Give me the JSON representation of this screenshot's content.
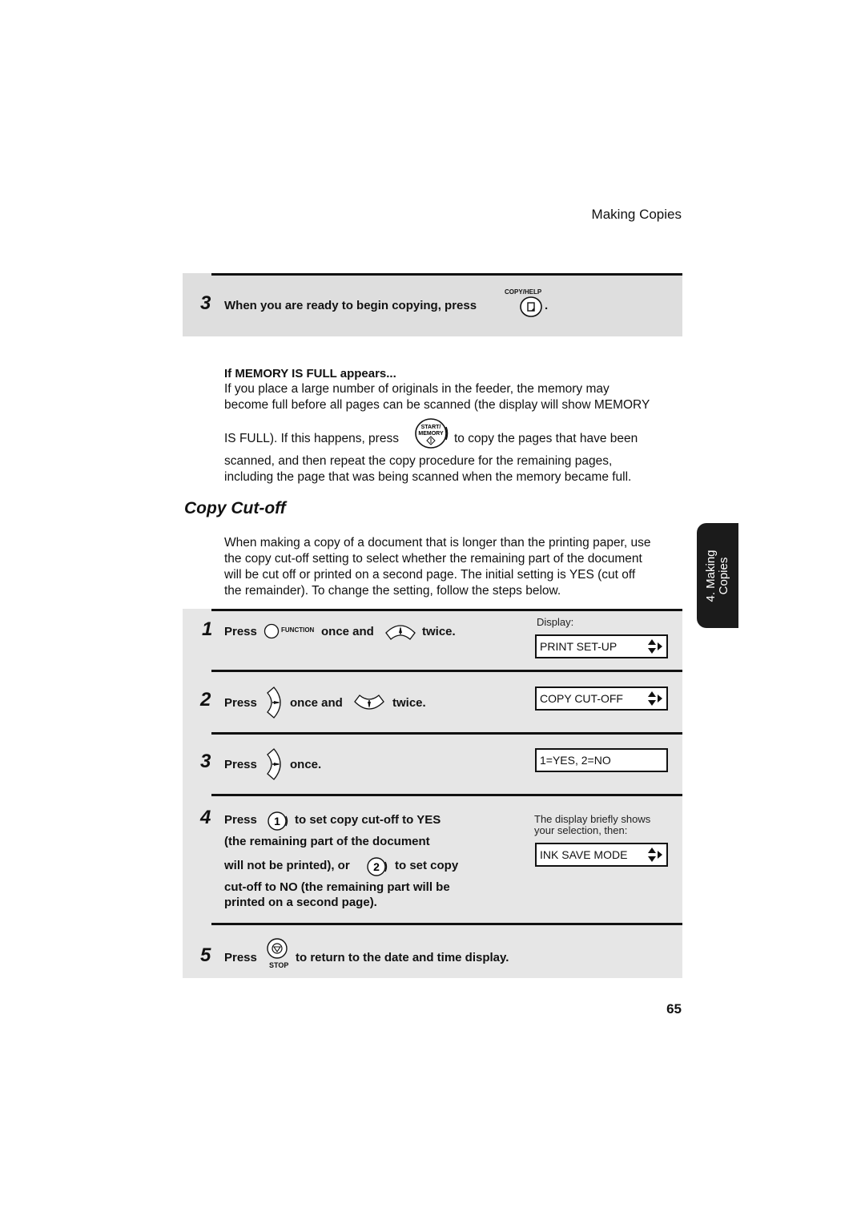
{
  "running_header": "Making Copies",
  "top_step": {
    "number": "3",
    "text": "When you are ready to begin copying, press",
    "key_label": "COPY/HELP",
    "suffix": "."
  },
  "memory_note": {
    "title": "If MEMORY IS FULL appears...",
    "line1": "If you place a large number of originals in the feeder, the memory may",
    "line2": "become full before all pages can be scanned (the display will show MEMORY",
    "line3_before": "IS FULL). If this happens, press",
    "key_label_top": "START/",
    "key_label_bottom": "MEMORY",
    "line3_after": "to copy the pages that have been",
    "line4": "scanned, and then repeat the copy procedure for the remaining pages,",
    "line5": "including the page that was being scanned when the memory became full."
  },
  "section": {
    "heading": "Copy Cut-off",
    "intro": [
      "When making a copy of a document that is longer than the printing paper, use",
      "the copy cut-off setting to select whether the remaining part of the document",
      "will be cut off or printed on a second page. The initial setting is YES (cut off",
      "the remainder). To change the setting, follow the steps below."
    ]
  },
  "side_tab": {
    "line1": "4. Making",
    "line2": "Copies"
  },
  "display_label": "Display:",
  "steps": [
    {
      "number": "1",
      "press": "Press",
      "key1": "FUNCTION",
      "mid": "once and",
      "end": "twice.",
      "lcd": "PRINT SET-UP"
    },
    {
      "number": "2",
      "press": "Press",
      "mid": "once and",
      "end": "twice.",
      "lcd": "COPY CUT-OFF"
    },
    {
      "number": "3",
      "press": "Press",
      "end": "once.",
      "lcd": "1=YES, 2=NO"
    },
    {
      "number": "4",
      "press": "Press",
      "key1": "1",
      "text1": "to set copy cut-off to YES",
      "text2": "(the remaining part of the document",
      "text3": "will not be printed), or",
      "key2": "2",
      "text3b": "to set copy",
      "text4": "cut-off to NO (the remaining part will be",
      "text5": "printed on a second page).",
      "note": "The display briefly shows",
      "note2": "your selection, then:",
      "lcd": "INK SAVE MODE"
    },
    {
      "number": "5",
      "press": "Press",
      "key_label": "STOP",
      "text": "to return to the date and time display."
    }
  ],
  "page_number": "65"
}
